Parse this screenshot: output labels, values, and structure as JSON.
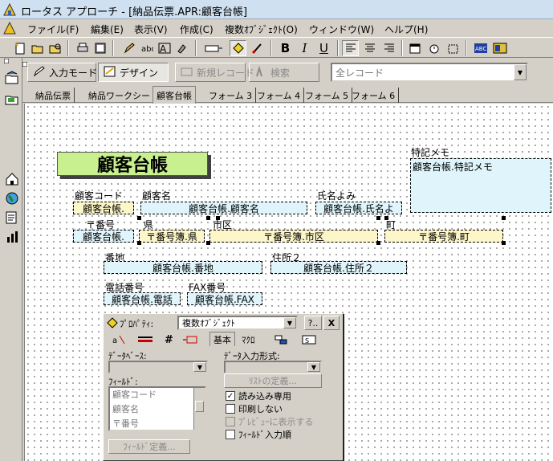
{
  "window": {
    "title": "ロータス アプローチ - [納品伝票.APR:顧客台帳]"
  },
  "menu": [
    "ファイル(F)",
    "編集(E)",
    "表示(V)",
    "作成(C)",
    "複数ｵﾌﾞｼﾞｪｸﾄ(O)",
    "ウィンドウ(W)",
    "ヘルプ(H)"
  ],
  "toolbar": {
    "bold_label": "B",
    "italic_label": "I",
    "underline_label": "U"
  },
  "modebar": {
    "input_mode_label": "入力モード",
    "design_label": "デザイン",
    "new_record_label": "新規レコード",
    "search_label": "検索",
    "record_filter_value": "全レコード"
  },
  "tabs": [
    "納品伝票",
    "納品ワークシート",
    "顧客台帳",
    "フォーム 3",
    "フォーム 4",
    "フォーム 5",
    "フォーム 6"
  ],
  "active_tab_index": 2,
  "form": {
    "title": "顧客台帳",
    "labels": {
      "customer_code": "顧客コード",
      "customer_name": "顧客名",
      "name_reading": "氏名よみ",
      "memo": "特記メモ",
      "postal": "〒番号",
      "prefecture": "県",
      "city": "市区",
      "town": "町",
      "street_number": "番地",
      "address2": "住所２",
      "phone": "電話番号",
      "fax": "FAX番号"
    },
    "fields": {
      "customer_code": "顧客台帳.",
      "customer_name": "顧客台帳.顧客名",
      "name_reading": "顧客台帳.氏名よ",
      "memo": "顧客台帳.特記メモ",
      "postal": "顧客台帳.",
      "prefecture": "〒番号簿.県",
      "city": "〒番号簿.市区",
      "town": "〒番号簿.町",
      "street_number": "顧客台帳.番地",
      "address2": "顧客台帳.住所２",
      "phone": "顧客台帳.電話",
      "fax": "顧客台帳.FAX"
    }
  },
  "properties": {
    "title": "ﾌﾟﾛﾊﾟﾃｨ:",
    "object_type": "複数ｵﾌﾞｼﾞｪｸﾄ",
    "help_label": "?..",
    "close_label": "X",
    "tabs": {
      "basic": "基本",
      "macro": "ﾏｸﾛ"
    },
    "database_label": "ﾃﾞｰﾀﾍﾞｰｽ:",
    "input_format_label": "ﾃﾞｰﾀ入力形式:",
    "list_def_button": "ﾘｽﾄの定義...",
    "fields_label": "ﾌｨｰﾙﾄﾞ:",
    "field_list": [
      "顧客コード",
      "顧客名",
      "〒番号",
      "番地"
    ],
    "field_def_button": "ﾌｨｰﾙﾄﾞ定義...",
    "checks": [
      {
        "label": "読み込み専用",
        "checked": true,
        "disabled": false
      },
      {
        "label": "印刷しない",
        "checked": false,
        "disabled": false
      },
      {
        "label": "ﾌﾟﾚﾋﾞｭｰに表示する",
        "checked": false,
        "disabled": true
      },
      {
        "label": "ﾌｨｰﾙﾄﾞ入力順",
        "checked": false,
        "disabled": false
      }
    ]
  }
}
